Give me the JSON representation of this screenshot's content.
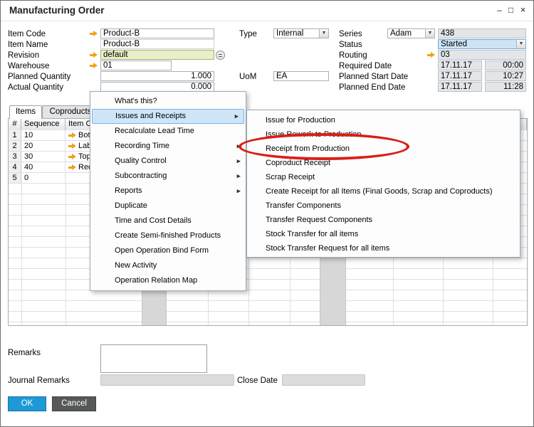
{
  "window": {
    "title": "Manufacturing Order",
    "controls": {
      "minimize": "–",
      "maximize": "□",
      "close": "×"
    }
  },
  "icons": {
    "link_arrow": "css-orange-arrow",
    "dropdown_arrow": "▼",
    "submenu_arrow": "▶",
    "edit_icon": "css-circle-lines"
  },
  "colors": {
    "ok_button": "#1e99d6",
    "cancel_button": "#57585a",
    "menu_highlight": "#cfe6f8",
    "annotation_red": "#dd1d15",
    "link_arrow_orange": "#f0a01e",
    "status_selected_bg": "#cde4f7",
    "revision_field_bg": "#e9efc8"
  },
  "form": {
    "item_code": {
      "label": "Item Code",
      "value": "Product-B"
    },
    "item_name": {
      "label": "Item Name",
      "value": "Product-B"
    },
    "revision": {
      "label": "Revision",
      "value": "default"
    },
    "warehouse": {
      "label": "Warehouse",
      "value": "01"
    },
    "planned_quantity": {
      "label": "Planned Quantity",
      "value": "1.000"
    },
    "actual_quantity": {
      "label": "Actual Quantity",
      "value": "0.000"
    },
    "type": {
      "label": "Type",
      "value": "Internal"
    },
    "uom": {
      "label": "UoM",
      "value": "EA"
    },
    "series": {
      "label": "Series",
      "value": "Adam",
      "number": "438"
    },
    "status": {
      "label": "Status",
      "value": "Started"
    },
    "routing": {
      "label": "Routing",
      "value": "03"
    },
    "required_date": {
      "label": "Required Date",
      "date": "17.11.17",
      "time": "00:00"
    },
    "planned_start_date": {
      "label": "Planned Start Date",
      "date": "17.11.17",
      "time": "10:27"
    },
    "planned_end_date": {
      "label": "Planned End Date",
      "date": "17.11.17",
      "time": "11:28"
    }
  },
  "tabs": [
    {
      "label": "Items"
    },
    {
      "label": "Coproducts"
    }
  ],
  "grid": {
    "headers": [
      "#",
      "Sequence",
      "Item Code"
    ],
    "rows": [
      {
        "num": "1",
        "sequence": "10",
        "item": "Bot"
      },
      {
        "num": "2",
        "sequence": "20",
        "item": "Lab"
      },
      {
        "num": "3",
        "sequence": "30",
        "item": "Top"
      },
      {
        "num": "4",
        "sequence": "40",
        "item": "Rec"
      },
      {
        "num": "5",
        "sequence": "0",
        "item": ""
      }
    ]
  },
  "context_menu": {
    "items": [
      {
        "label": "What's this?"
      },
      {
        "label": "Issues and Receipts",
        "submenu": true,
        "highlighted": true
      },
      {
        "label": "Recalculate Lead Time"
      },
      {
        "label": "Recording Time",
        "submenu": true
      },
      {
        "label": "Quality Control",
        "submenu": true
      },
      {
        "label": "Subcontracting",
        "submenu": true
      },
      {
        "label": "Reports",
        "submenu": true
      },
      {
        "label": "Duplicate"
      },
      {
        "label": "Time and Cost Details"
      },
      {
        "label": "Create Semi-finished Products"
      },
      {
        "label": "Open Operation Bind Form"
      },
      {
        "label": "New Activity"
      },
      {
        "label": "Operation Relation Map"
      }
    ]
  },
  "submenu": {
    "items": [
      {
        "label": "Issue for Production"
      },
      {
        "label": "Issue Rework to Production"
      },
      {
        "label": "Receipt from Production",
        "circled": true
      },
      {
        "label": "Coproduct Receipt"
      },
      {
        "label": "Scrap Receipt"
      },
      {
        "label": "Create Receipt for all Items (Final Goods, Scrap and Coproducts)"
      },
      {
        "label": "Transfer Components"
      },
      {
        "label": "Transfer Request Components"
      },
      {
        "label": "Stock Transfer for all items"
      },
      {
        "label": "Stock Transfer Request for all items"
      }
    ]
  },
  "annotation": {
    "shape": "ellipse",
    "color": "#dd1d15",
    "target": "Receipt from Production"
  },
  "remarks": {
    "label": "Remarks",
    "value": ""
  },
  "journal_remarks": {
    "label": "Journal Remarks",
    "value": ""
  },
  "close_date": {
    "label": "Close Date",
    "value": ""
  },
  "buttons": {
    "ok": "OK",
    "cancel": "Cancel"
  }
}
